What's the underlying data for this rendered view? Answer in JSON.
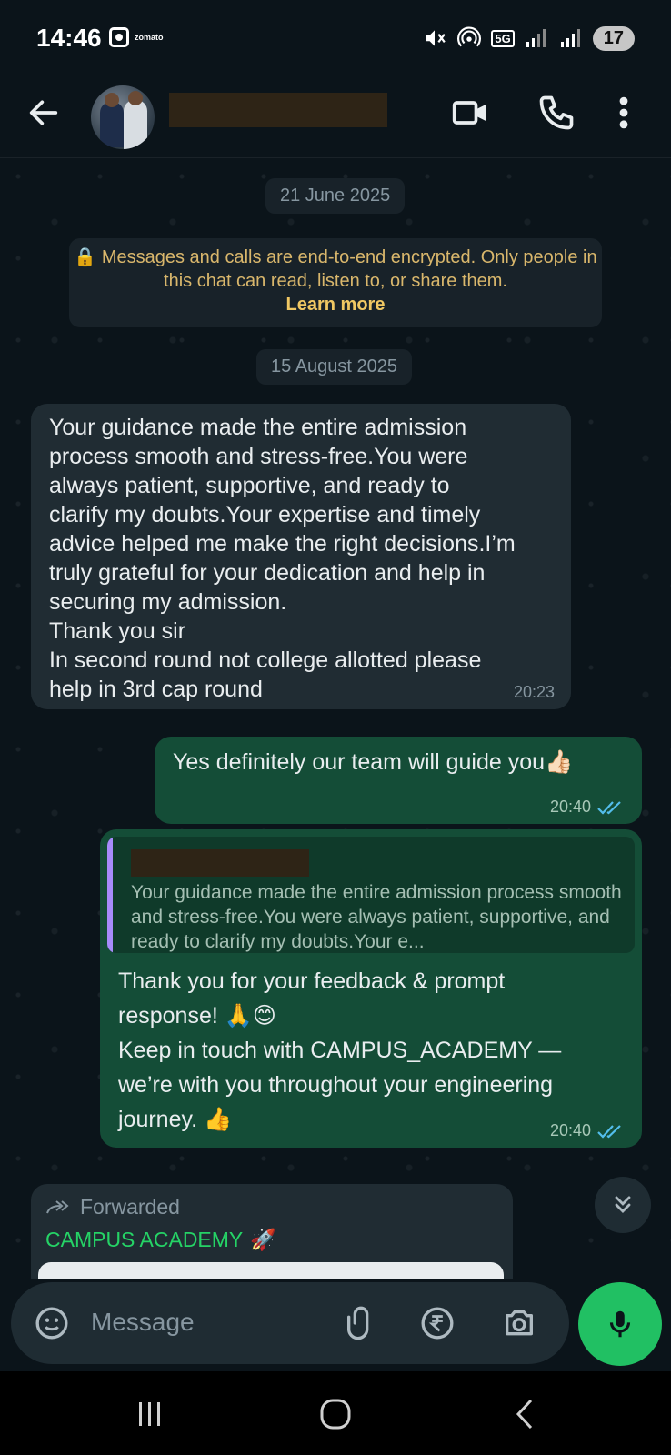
{
  "status_bar": {
    "time": "14:46",
    "app_label": "zomato",
    "network": "5G",
    "battery": "17"
  },
  "header": {
    "back_icon": "back-arrow-icon",
    "video_icon": "video-call-icon",
    "call_icon": "phone-icon",
    "menu_icon": "more-vert-icon"
  },
  "chat": {
    "date_1": "21 June 2025",
    "encryption_notice": "Messages and calls are end-to-end encrypted. Only people in this chat can read, listen to, or share them.",
    "learn_more": "Learn more",
    "date_2": "15 August 2025",
    "messages": [
      {
        "direction": "incoming",
        "text": "Your guidance made the entire admission\nprocess smooth and stress-free.You were\nalways patient, supportive, and ready to\nclarify my doubts.Your expertise and timely\nadvice helped me make the right decisions.I’m\ntruly grateful for your dedication and help in\nsecuring my admission.\nThank you sir\nIn second round not college allotted please\nhelp in 3rd cap round",
        "time": "20:23"
      },
      {
        "direction": "outgoing",
        "text": "Yes definitely our team will guide you👍🏻",
        "time": "20:40",
        "status": "read"
      },
      {
        "direction": "outgoing",
        "quoted_text": "Your guidance made the entire admission process smooth and stress-free.You were always patient, supportive, and ready to clarify my doubts.Your e...",
        "text": "Thank you for your feedback & prompt\nresponse! 🙏😊\nKeep in touch with CAMPUS_ACADEMY —\nwe’re with you throughout your engineering\njourney. 👍",
        "time": "20:40",
        "status": "read"
      }
    ],
    "forwarded": {
      "label": "Forwarded",
      "sender": "CAMPUS ACADEMY",
      "sender_emoji": "🚀"
    }
  },
  "composer": {
    "placeholder": "Message"
  },
  "colors": {
    "background": "#0b141a",
    "incoming_bubble": "#202c33",
    "outgoing_bubble": "#144d37",
    "accent_green": "#21c063",
    "read_ticks": "#53bdeb"
  }
}
